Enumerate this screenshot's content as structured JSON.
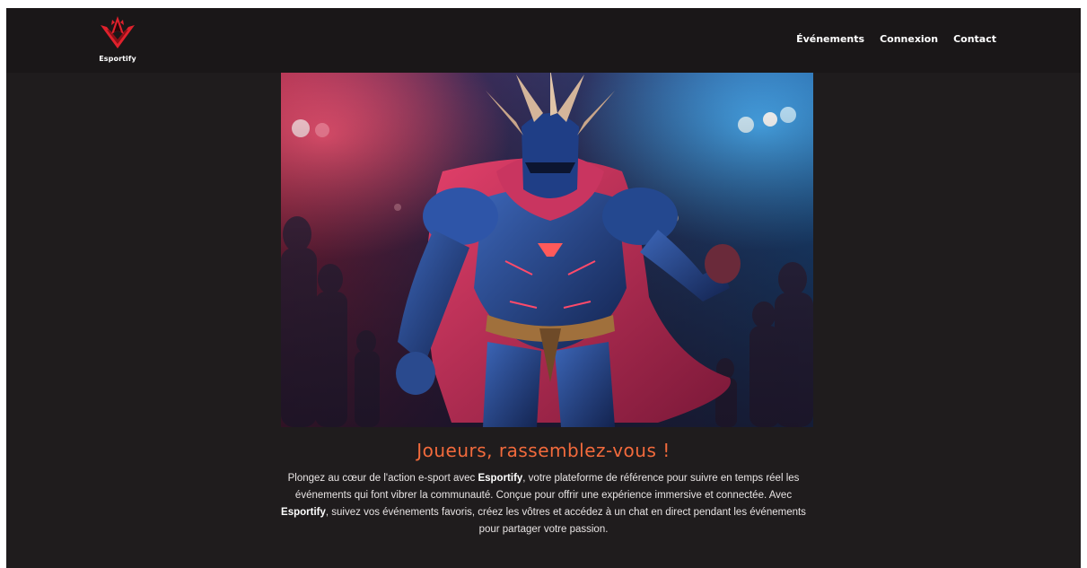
{
  "brand": {
    "name": "Esportify"
  },
  "nav": {
    "items": [
      {
        "label": "Événements"
      },
      {
        "label": "Connexion"
      },
      {
        "label": "Contact"
      }
    ]
  },
  "hero": {
    "image_description_icon": "armored-hero-image"
  },
  "main": {
    "title": "Joueurs, rassemblez-vous !",
    "intro": {
      "part1": "Plongez au cœur de l'action e-sport avec ",
      "brand1": "Esportify",
      "part2": ", votre plateforme de référence pour suivre en temps réel les événements qui font vibrer la communauté. Conçue pour offrir une expérience immersive et connectée. Avec ",
      "brand2": "Esportify",
      "part3": ", suivez vos événements favoris, créez les vôtres et accédez à un chat en direct pendant les événements pour partager votre passion."
    }
  },
  "colors": {
    "background": "#1f1c1d",
    "navbar": "#1a1718",
    "accent": "#f26a3c",
    "logo_red": "#e0212c"
  }
}
